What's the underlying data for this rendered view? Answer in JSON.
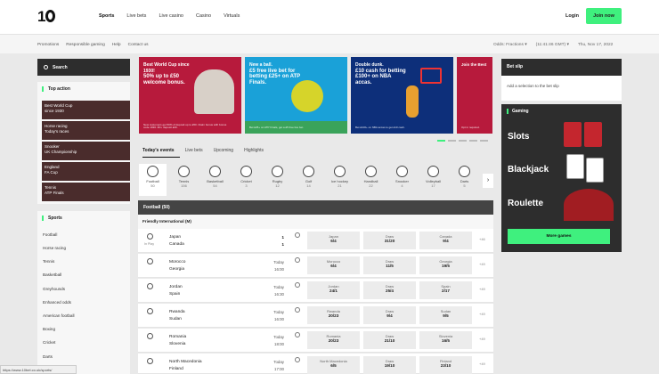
{
  "header": {
    "logo": "10",
    "nav": [
      "Sports",
      "Live bets",
      "Live casino",
      "Casino",
      "Virtuals"
    ],
    "login": "Login",
    "join": "Join now"
  },
  "subnav": {
    "links": [
      "Promotions",
      "Responsible gaming",
      "Help",
      "Contact us"
    ],
    "odds": "Odds: Fractions ▾",
    "time": "(11:41:46 GMT) ▾",
    "date": "Thu, Nov 17, 2022"
  },
  "search": {
    "label": "Search"
  },
  "top_action": {
    "title": "Top action",
    "tiles": [
      {
        "l1": "Best World Cup",
        "l2": "since 1930"
      },
      {
        "l1": "Horse racing",
        "l2": "Today's races"
      },
      {
        "l1": "Snooker",
        "l2": "UK Championship"
      },
      {
        "l1": "England",
        "l2": "FA Cup"
      },
      {
        "l1": "Tennis",
        "l2": "ATP Finals"
      }
    ]
  },
  "sports_menu": {
    "title": "Sports",
    "items": [
      "Football",
      "Horse racing",
      "Tennis",
      "Basketball",
      "Greyhounds",
      "Enhanced odds",
      "American football",
      "Boxing",
      "Cricket",
      "Darts"
    ]
  },
  "banners": [
    {
      "title": "Best World Cup since 1930!",
      "text": "50% up to £50 welcome bonus.",
      "small": "New customers get 50% of deposit up to £50. Claim bonus with bonus code 1930. Min. deposit £20.",
      "color": "#b71a3c"
    },
    {
      "title": "New a ball.",
      "text": "£5 free live bet for betting £25+ on ATP Finals.",
      "small": "Bet £25+ on ATP Finals, get a £5 free live bet.",
      "color": "#1aa1d8"
    },
    {
      "title": "Double dunk.",
      "text": "£10 cash for betting £100+ on NBA accas.",
      "small": "Bet £100+ on NBA accas to get £10 cash.",
      "color": "#0d2f7a"
    },
    {
      "title": "Join the Best",
      "text": "",
      "small": "Opt in required.",
      "color": "#b71a3c"
    }
  ],
  "events": {
    "tabs": [
      "Today's events",
      "Live bets",
      "Upcoming",
      "Highlights"
    ],
    "sports": [
      {
        "name": "Football",
        "count": "50"
      },
      {
        "name": "Tennis",
        "count": "156"
      },
      {
        "name": "Basketball",
        "count": "54"
      },
      {
        "name": "Cricket",
        "count": "3"
      },
      {
        "name": "Rugby",
        "count": "12"
      },
      {
        "name": "Golf",
        "count": "14"
      },
      {
        "name": "Ice hockey",
        "count": "21"
      },
      {
        "name": "Handball",
        "count": "22"
      },
      {
        "name": "Snooker",
        "count": "4"
      },
      {
        "name": "Volleyball",
        "count": "17"
      },
      {
        "name": "Darts",
        "count": "5"
      }
    ],
    "section": "Football (50)",
    "competition": "Friendly International (M)",
    "matches": [
      {
        "home": "Japan",
        "away": "Canada",
        "time1": "1",
        "time2": "1",
        "inplay": "In Play",
        "o1": {
          "l": "Japan",
          "v": "6/4"
        },
        "ox": {
          "l": "Draw",
          "v": "31/20"
        },
        "o2": {
          "l": "Canada",
          "v": "9/4"
        },
        "more": "+46"
      },
      {
        "home": "Morocco",
        "away": "Georgia",
        "time1": "Today",
        "time2": "16:00",
        "o1": {
          "l": "Morocco",
          "v": "6/4"
        },
        "ox": {
          "l": "Draw",
          "v": "11/5"
        },
        "o2": {
          "l": "Georgia",
          "v": "19/5"
        },
        "more": "+49"
      },
      {
        "home": "Jordan",
        "away": "Spain",
        "time1": "Today",
        "time2": "16:30",
        "o1": {
          "l": "Jordan",
          "v": "24/1"
        },
        "ox": {
          "l": "Draw",
          "v": "25/4"
        },
        "o2": {
          "l": "Spain",
          "v": "2/17"
        },
        "more": "+49"
      },
      {
        "home": "Rwanda",
        "away": "Sudan",
        "time1": "Today",
        "time2": "16:00",
        "o1": {
          "l": "Rwanda",
          "v": "20/23"
        },
        "ox": {
          "l": "Draw",
          "v": "9/4"
        },
        "o2": {
          "l": "Sudan",
          "v": "9/5"
        },
        "more": "+49"
      },
      {
        "home": "Romania",
        "away": "Slovenia",
        "time1": "Today",
        "time2": "18:00",
        "o1": {
          "l": "Romania",
          "v": "20/23"
        },
        "ox": {
          "l": "Draw",
          "v": "21/10"
        },
        "o2": {
          "l": "Slovenia",
          "v": "16/5"
        },
        "more": "+49"
      },
      {
        "home": "North Macedonia",
        "away": "Finland",
        "time1": "Today",
        "time2": "17:00",
        "o1": {
          "l": "North Macedonia",
          "v": "6/5"
        },
        "ox": {
          "l": "Draw",
          "v": "19/10"
        },
        "o2": {
          "l": "Finland",
          "v": "23/10"
        },
        "more": "+49"
      }
    ]
  },
  "betslip": {
    "title": "Bet slip",
    "empty": "Add a selection to the bet slip"
  },
  "gaming": {
    "title": "Gaming",
    "games": [
      "Slots",
      "Blackjack",
      "Roulette"
    ],
    "more": "More games"
  },
  "statusbar": {
    "url": "https://www.10bet.co.uk/sports/"
  },
  "colors": {
    "accent": "#3ff07e",
    "dark": "#2d2d2d",
    "tile": "#4a2c2c"
  }
}
